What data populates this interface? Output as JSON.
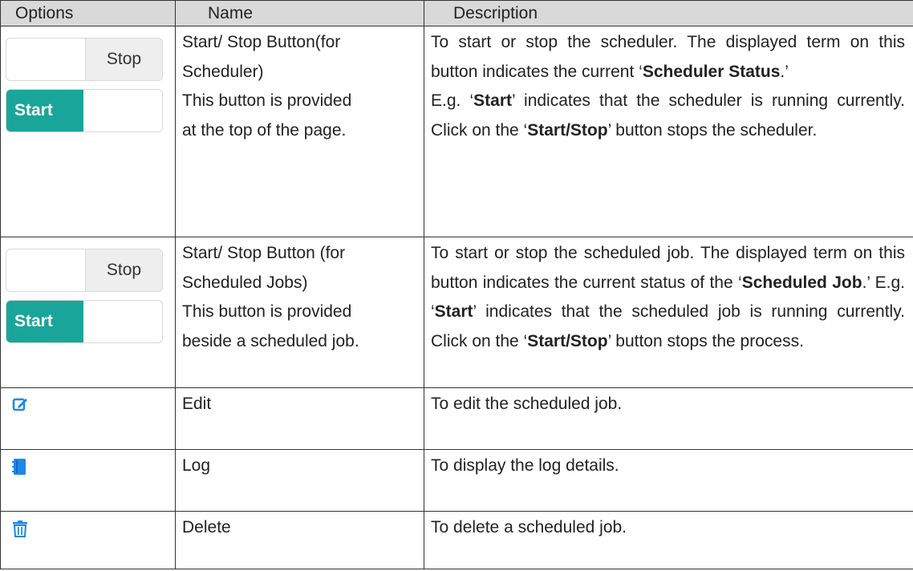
{
  "headers": {
    "options": "Options",
    "name": "Name",
    "description": "Description"
  },
  "rows": [
    {
      "toggle_stop": "Stop",
      "toggle_start": "Start",
      "name_lines": [
        "Start/ Stop Button(for",
        "Scheduler)",
        "This button is provided",
        "at the top of the page."
      ],
      "desc": {
        "p1": "To start or stop the scheduler. The displayed term on this button indicates the current ‘",
        "b1": "Scheduler Status",
        "p2": ".’",
        "p3": "E.g. ‘",
        "b2": "Start",
        "p4": "’ indicates that the scheduler is running currently. Click on the ‘",
        "b3": "Start/Stop",
        "p5": "’ button stops the scheduler."
      }
    },
    {
      "toggle_stop": "Stop",
      "toggle_start": "Start",
      "name_lines": [
        "Start/ Stop Button (for",
        "Scheduled Jobs)",
        "This button is provided",
        "beside a scheduled job."
      ],
      "desc": {
        "p1": "To start or stop the scheduled job. The displayed term on this button indicates the current status of the ‘",
        "b1": "Scheduled Job",
        "p2": ".’ E.g. ‘",
        "b2": "Start",
        "p3": "’ indicates that the scheduled job is running currently. Click on the ‘",
        "b3": "Start/Stop",
        "p4": "’ button stops the process."
      }
    },
    {
      "icon": "edit-icon",
      "name": "Edit",
      "desc": "To edit the scheduled job."
    },
    {
      "icon": "log-book-icon",
      "name": "Log",
      "desc": "To display the log details."
    },
    {
      "icon": "trash-icon",
      "name": "Delete",
      "desc": "To delete a scheduled job."
    }
  ],
  "colors": {
    "accent": "#1aa59a",
    "icon_blue": "#1e88e5",
    "header_bg": "#d9d9d9"
  }
}
